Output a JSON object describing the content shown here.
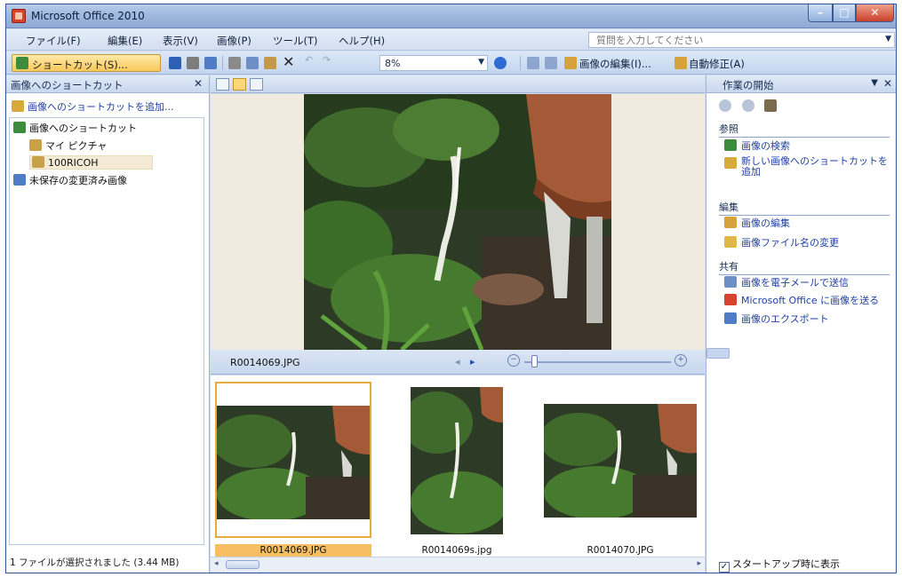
{
  "window": {
    "title": "Microsoft Office 2010"
  },
  "menu": [
    "ファイル(F)",
    "編集(E)",
    "表示(V)",
    "画像(P)",
    "ツール(T)",
    "ヘルプ(H)"
  ],
  "help_search": {
    "placeholder": "質問を入力してください"
  },
  "toolbar": {
    "shortcut_label": "ショートカット(S)...",
    "zoom_value": "8%",
    "edit_picture_label": "画像の編集(I)...",
    "auto_correct_label": "自動修正(A)"
  },
  "left_pane": {
    "title": "画像へのショートカット",
    "add_link": "画像へのショートカットを追加...",
    "tree": [
      "画像へのショートカット",
      "マイ ピクチャ",
      "100RICOH",
      "未保存の変更済み画像"
    ],
    "status": "1 ファイルが選択されました (3.44 MB)"
  },
  "preview": {
    "filename": "R0014069.JPG"
  },
  "thumbnails": [
    "R0014069.JPG",
    "R0014069s.jpg",
    "R0014070.JPG"
  ],
  "right_pane": {
    "title": "作業の開始",
    "sections": {
      "browse": {
        "label": "参照",
        "tasks": [
          "画像の検索",
          "新しい画像へのショートカットを追加"
        ]
      },
      "edit": {
        "label": "編集",
        "tasks": [
          "画像の編集",
          "画像ファイル名の変更"
        ]
      },
      "share": {
        "label": "共有",
        "tasks": [
          "画像を電子メールで送信",
          "Microsoft Office に画像を送る",
          "画像のエクスポート"
        ]
      }
    },
    "show_at_startup": "スタートアップ時に表示"
  }
}
